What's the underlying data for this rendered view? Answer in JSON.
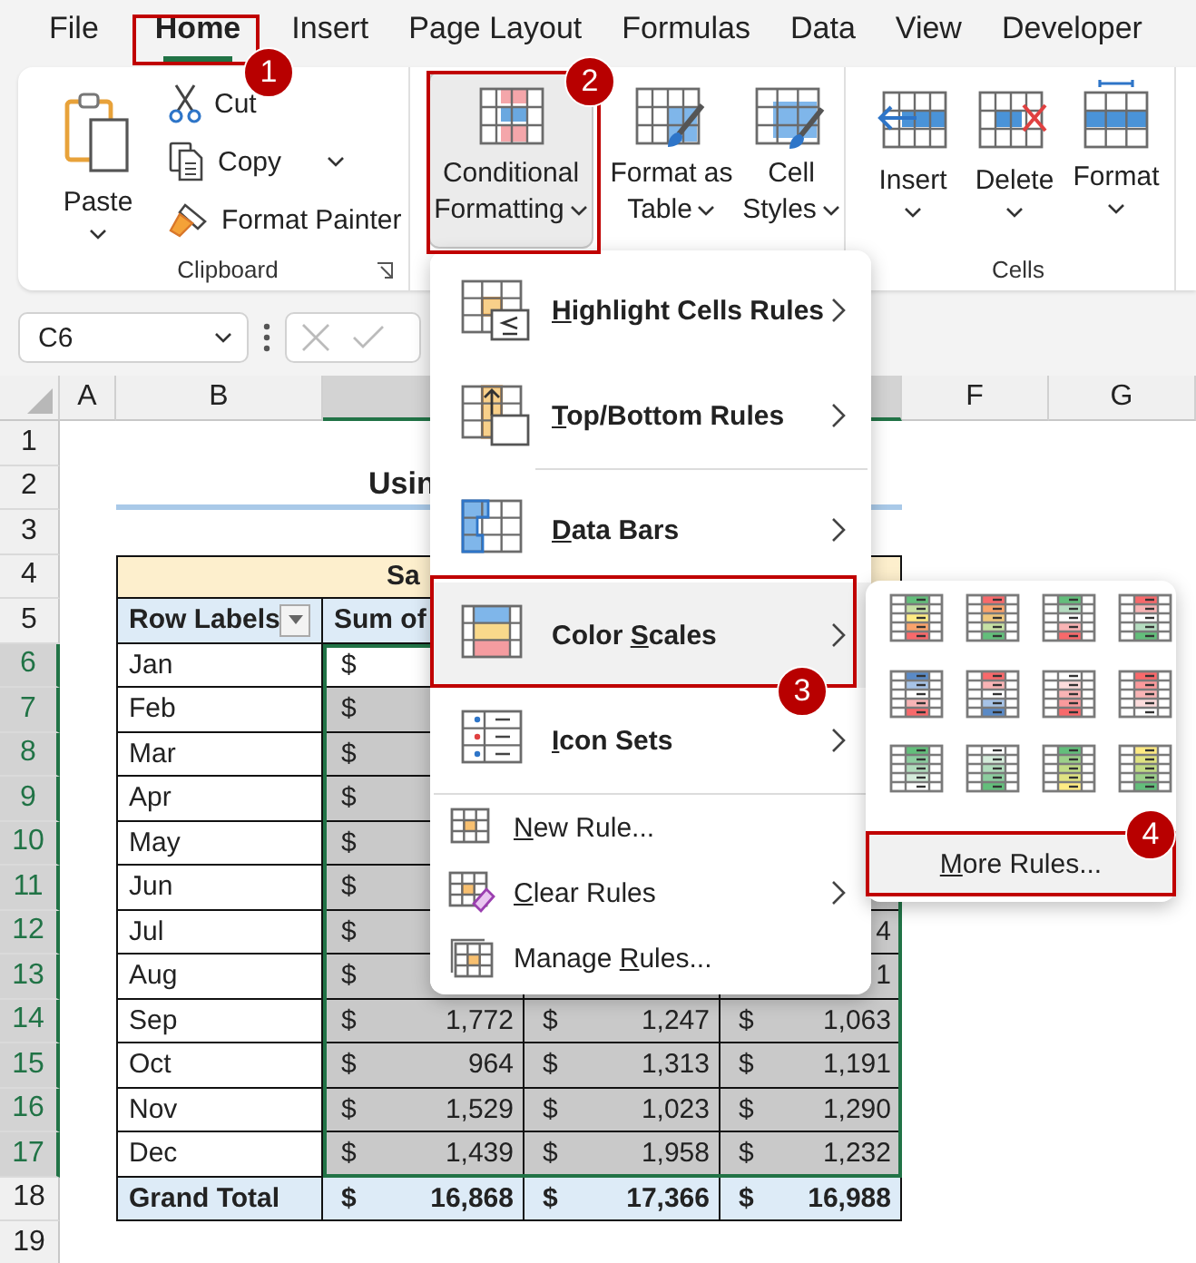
{
  "ribbon_tabs": [
    {
      "label": "File",
      "selected": false
    },
    {
      "label": "Home",
      "selected": true
    },
    {
      "label": "Insert",
      "selected": false
    },
    {
      "label": "Page Layout",
      "selected": false
    },
    {
      "label": "Formulas",
      "selected": false
    },
    {
      "label": "Data",
      "selected": false
    },
    {
      "label": "View",
      "selected": false
    },
    {
      "label": "Developer",
      "selected": false
    }
  ],
  "clipboard_group": {
    "paste": "Paste",
    "cut": "Cut",
    "copy": "Copy",
    "format_painter": "Format Painter",
    "label": "Clipboard"
  },
  "styles_group": {
    "conditional_formatting": {
      "label": "Conditional Formatting",
      "expanded": true
    },
    "format_as_table": "Format as Table",
    "cell_styles": "Cell Styles"
  },
  "cells_group": {
    "insert": "Insert",
    "delete": "Delete",
    "format": "Format",
    "label": "Cells"
  },
  "formula_bar": {
    "name_box": "C6"
  },
  "sheet": {
    "column_headers": [
      "A",
      "B",
      "F",
      "G"
    ],
    "row_numbers": [
      {
        "label": "1",
        "selected": false
      },
      {
        "label": "2",
        "selected": false
      },
      {
        "label": "3",
        "selected": false
      },
      {
        "label": "4",
        "selected": false
      },
      {
        "label": "5",
        "selected": false
      },
      {
        "label": "6",
        "selected": true
      },
      {
        "label": "7",
        "selected": true
      },
      {
        "label": "8",
        "selected": true
      },
      {
        "label": "9",
        "selected": true
      },
      {
        "label": "10",
        "selected": true
      },
      {
        "label": "11",
        "selected": true
      },
      {
        "label": "12",
        "selected": true
      },
      {
        "label": "13",
        "selected": true
      },
      {
        "label": "14",
        "selected": true
      },
      {
        "label": "15",
        "selected": true
      },
      {
        "label": "16",
        "selected": true
      },
      {
        "label": "17",
        "selected": true
      },
      {
        "label": "18",
        "selected": false
      },
      {
        "label": "19",
        "selected": false
      }
    ],
    "title": "Usin",
    "table_title": "Sa",
    "row_labels_header": "Row Labels",
    "sum_header": "Sum of",
    "rows": [
      {
        "label": "Jan",
        "c": {
          "currency": "$",
          "active": true
        }
      },
      {
        "label": "Feb",
        "c": {
          "currency": "$",
          "active": false
        }
      },
      {
        "label": "Mar",
        "c": {
          "currency": "$",
          "active": false
        }
      },
      {
        "label": "Apr",
        "c": {
          "currency": "$",
          "active": false
        }
      },
      {
        "label": "May",
        "c": {
          "currency": "$",
          "active": false
        }
      },
      {
        "label": "Jun",
        "c": {
          "currency": "$",
          "active": false
        }
      },
      {
        "label": "Jul",
        "c": {
          "currency": "$",
          "active": false
        },
        "e": {
          "amount": "4"
        }
      },
      {
        "label": "Aug",
        "c": {
          "currency": "$",
          "active": false
        },
        "e": {
          "amount": "1"
        }
      },
      {
        "label": "Sep",
        "c": {
          "currency": "$",
          "amount": "1,772",
          "active": false
        },
        "d": {
          "currency": "$",
          "amount": "1,247"
        },
        "e": {
          "currency": "$",
          "amount": "1,063"
        }
      },
      {
        "label": "Oct",
        "c": {
          "currency": "$",
          "amount": "964",
          "active": false
        },
        "d": {
          "currency": "$",
          "amount": "1,313"
        },
        "e": {
          "currency": "$",
          "amount": "1,191"
        }
      },
      {
        "label": "Nov",
        "c": {
          "currency": "$",
          "amount": "1,529",
          "active": false
        },
        "d": {
          "currency": "$",
          "amount": "1,023"
        },
        "e": {
          "currency": "$",
          "amount": "1,290"
        }
      },
      {
        "label": "Dec",
        "c": {
          "currency": "$",
          "amount": "1,439",
          "active": false
        },
        "d": {
          "currency": "$",
          "amount": "1,958"
        },
        "e": {
          "currency": "$",
          "amount": "1,232"
        }
      }
    ],
    "grand_total": {
      "label": "Grand Total",
      "c": {
        "currency": "$",
        "amount": "16,868"
      },
      "d": {
        "currency": "$",
        "amount": "17,366"
      },
      "e": {
        "currency": "$",
        "amount": "16,988"
      }
    }
  },
  "conditional_formatting_menu": {
    "groups": [
      [
        {
          "kind": "large",
          "access_key": "H",
          "label_rest": "ighlight Cells Rules",
          "submenu": true,
          "selected": false
        },
        {
          "kind": "large",
          "access_key": "T",
          "label_rest": "op/Bottom Rules",
          "submenu": true,
          "selected": false
        }
      ],
      [
        {
          "kind": "large",
          "access_key": "D",
          "label_rest": "ata Bars",
          "submenu": true,
          "selected": false
        },
        {
          "kind": "large",
          "label_start": "Color ",
          "access_key": "S",
          "label_rest": "cales",
          "submenu": true,
          "selected": true
        },
        {
          "kind": "large",
          "access_key": "I",
          "label_rest": "con Sets",
          "submenu": true,
          "selected": false
        }
      ],
      [
        {
          "kind": "small",
          "access_key": "N",
          "label_rest": "ew Rule...",
          "submenu": false,
          "selected": false
        },
        {
          "kind": "small",
          "access_key": "C",
          "label_rest": "lear Rules",
          "submenu": true,
          "selected": false
        },
        {
          "kind": "small",
          "label_start": "Manage ",
          "access_key": "R",
          "label_rest": "ules...",
          "submenu": false,
          "selected": false
        }
      ]
    ]
  },
  "color_scales_menu": {
    "scales": [
      {
        "bands": [
          {
            "color": "#63be7b"
          },
          {
            "color": "#c6e0a4"
          },
          {
            "color": "#ffeb84"
          },
          {
            "color": "#f9a36c"
          },
          {
            "color": "#f8696b"
          }
        ]
      },
      {
        "bands": [
          {
            "color": "#f8696b"
          },
          {
            "color": "#f9a36c"
          },
          {
            "color": "#f0c77c"
          },
          {
            "color": "#c6e0a4"
          },
          {
            "color": "#63be7b"
          }
        ]
      },
      {
        "bands": [
          {
            "color": "#63be7b"
          },
          {
            "color": "#b5dcc0"
          },
          {
            "color": "#ffffff"
          },
          {
            "color": "#f8b4b5"
          },
          {
            "color": "#f8696b"
          }
        ]
      },
      {
        "bands": [
          {
            "color": "#f8696b"
          },
          {
            "color": "#f8b4b5"
          },
          {
            "color": "#ffffff"
          },
          {
            "color": "#b5dcc0"
          },
          {
            "color": "#63be7b"
          }
        ]
      },
      {
        "bands": [
          {
            "color": "#5a8ac6"
          },
          {
            "color": "#a7c3e6"
          },
          {
            "color": "#ffffff"
          },
          {
            "color": "#f8b4b5"
          },
          {
            "color": "#f8696b"
          }
        ]
      },
      {
        "bands": [
          {
            "color": "#f8696b"
          },
          {
            "color": "#f8b4b5"
          },
          {
            "color": "#ffffff"
          },
          {
            "color": "#a7c3e6"
          },
          {
            "color": "#5a8ac6"
          }
        ]
      },
      {
        "bands": [
          {
            "color": "#ffffff"
          },
          {
            "color": "#fcdcdc"
          },
          {
            "color": "#f8b4b5"
          },
          {
            "color": "#f99a9c"
          },
          {
            "color": "#f8696b"
          }
        ]
      },
      {
        "bands": [
          {
            "color": "#f8696b"
          },
          {
            "color": "#f99a9c"
          },
          {
            "color": "#f8b4b5"
          },
          {
            "color": "#fcdcdc"
          },
          {
            "color": "#ffffff"
          }
        ]
      },
      {
        "bands": [
          {
            "color": "#63be7b"
          },
          {
            "color": "#8dcd9f"
          },
          {
            "color": "#b0dcbc"
          },
          {
            "color": "#d5ecdb"
          },
          {
            "color": "#ffffff"
          }
        ]
      },
      {
        "bands": [
          {
            "color": "#ffffff"
          },
          {
            "color": "#d5ecdb"
          },
          {
            "color": "#b0dcbc"
          },
          {
            "color": "#8dcd9f"
          },
          {
            "color": "#63be7b"
          }
        ]
      },
      {
        "bands": [
          {
            "color": "#63be7b"
          },
          {
            "color": "#9cd08a"
          },
          {
            "color": "#c2dc86"
          },
          {
            "color": "#e0e383"
          },
          {
            "color": "#ffeb84"
          }
        ]
      },
      {
        "bands": [
          {
            "color": "#ffeb84"
          },
          {
            "color": "#e0e383"
          },
          {
            "color": "#c2dc86"
          },
          {
            "color": "#9cd08a"
          },
          {
            "color": "#63be7b"
          }
        ]
      }
    ],
    "more_rules": {
      "access_key": "M",
      "label_rest": "ore Rules..."
    }
  },
  "callouts": [
    {
      "number": "1"
    },
    {
      "number": "2"
    },
    {
      "number": "3"
    },
    {
      "number": "4"
    }
  ]
}
